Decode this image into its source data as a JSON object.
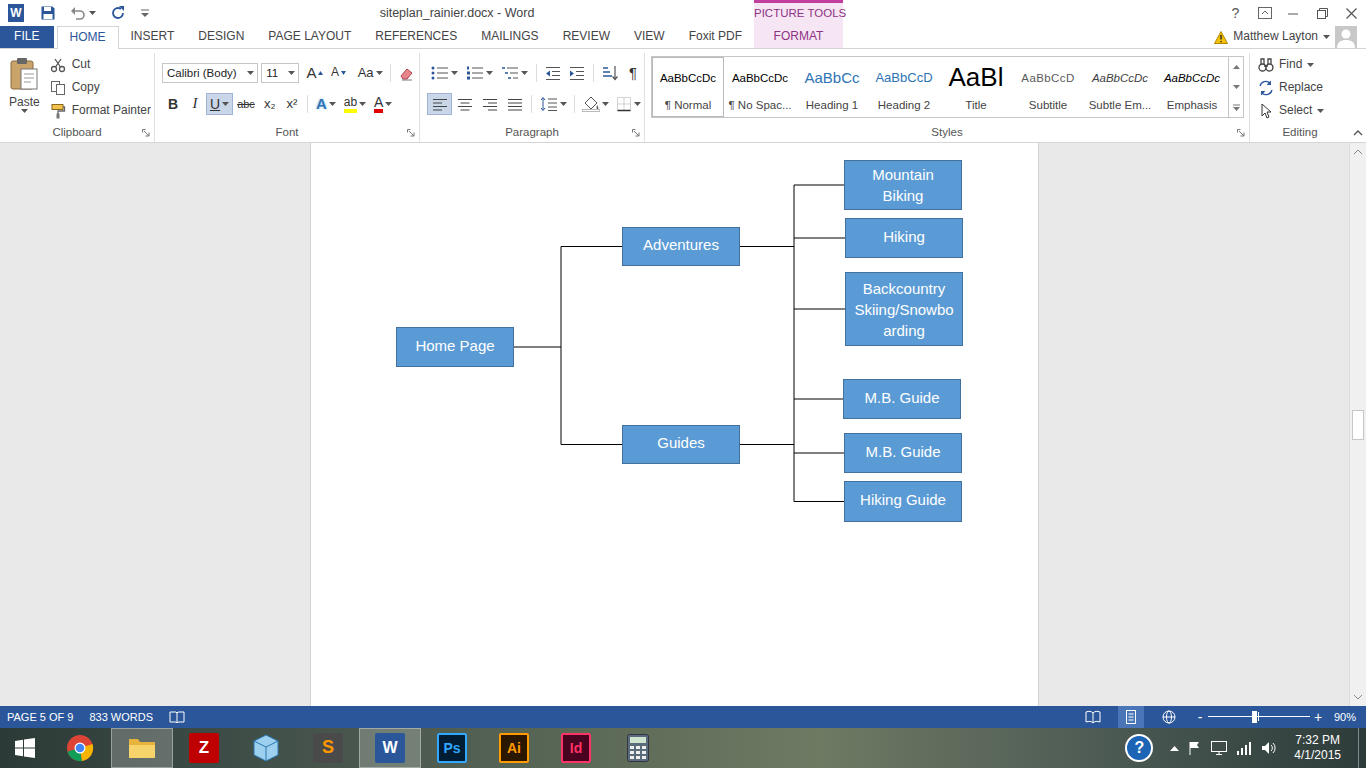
{
  "window": {
    "app_glyph": "W",
    "title": "siteplan_rainier.docx - Word",
    "context_group": "PICTURE TOOLS",
    "help": "?"
  },
  "tabs": [
    {
      "label": "FILE",
      "kind": "file",
      "selected": false
    },
    {
      "label": "HOME",
      "kind": "tab",
      "selected": true
    },
    {
      "label": "INSERT",
      "kind": "tab",
      "selected": false
    },
    {
      "label": "DESIGN",
      "kind": "tab",
      "selected": false
    },
    {
      "label": "PAGE LAYOUT",
      "kind": "tab",
      "selected": false
    },
    {
      "label": "REFERENCES",
      "kind": "tab",
      "selected": false
    },
    {
      "label": "MAILINGS",
      "kind": "tab",
      "selected": false
    },
    {
      "label": "REVIEW",
      "kind": "tab",
      "selected": false
    },
    {
      "label": "VIEW",
      "kind": "tab",
      "selected": false
    },
    {
      "label": "Foxit PDF",
      "kind": "tab",
      "selected": false
    },
    {
      "label": "FORMAT",
      "kind": "context",
      "selected": false
    }
  ],
  "account": {
    "user": "Matthew Layton"
  },
  "ribbon": {
    "clipboard": {
      "label": "Clipboard",
      "paste": "Paste",
      "items": [
        "Cut",
        "Copy",
        "Format Painter"
      ]
    },
    "font": {
      "label": "Font",
      "font_name": "Calibri (Body)",
      "font_size": "11",
      "grow": "A",
      "shrink": "A",
      "change_case": "Aa",
      "buttons": [
        {
          "label": "B",
          "kind": "bold",
          "selected": false
        },
        {
          "label": "I",
          "kind": "italic",
          "selected": false
        },
        {
          "label": "U",
          "kind": "underline",
          "selected": true
        },
        {
          "label": "abc",
          "kind": "strike",
          "selected": false
        },
        {
          "label": "x₂",
          "kind": "subscript",
          "selected": false
        },
        {
          "label": "x²",
          "kind": "superscript",
          "selected": false
        },
        {
          "label": "A",
          "kind": "effects",
          "selected": false
        },
        {
          "label": "ab",
          "kind": "highlight",
          "selected": false
        },
        {
          "label": "A",
          "kind": "color",
          "selected": false
        }
      ]
    },
    "paragraph": {
      "label": "Paragraph",
      "show_marks": "¶",
      "align": [
        {
          "kind": "left",
          "selected": true
        },
        {
          "kind": "center",
          "selected": false
        },
        {
          "kind": "right",
          "selected": false
        },
        {
          "kind": "justify",
          "selected": false
        }
      ]
    },
    "styles": {
      "label": "Styles",
      "items": [
        {
          "preview": "AaBbCcDc",
          "label": "¶ Normal",
          "kind": "normal",
          "selected": true
        },
        {
          "preview": "AaBbCcDc",
          "label": "¶ No Spac...",
          "kind": "nospacing",
          "selected": false
        },
        {
          "preview": "AaBbCc",
          "label": "Heading 1",
          "kind": "heading1",
          "selected": false
        },
        {
          "preview": "AaBbCcD",
          "label": "Heading 2",
          "kind": "heading2",
          "selected": false
        },
        {
          "preview": "AaBl",
          "label": "Title",
          "kind": "title",
          "selected": false
        },
        {
          "preview": "AaBbCcD",
          "label": "Subtitle",
          "kind": "subtitle",
          "selected": false
        },
        {
          "preview": "AaBbCcDc",
          "label": "Subtle Em...",
          "kind": "subtle",
          "selected": false
        },
        {
          "preview": "AaBbCcDc",
          "label": "Emphasis",
          "kind": "emphasis",
          "selected": false
        }
      ]
    },
    "editing": {
      "label": "Editing",
      "items": [
        "Find",
        "Replace",
        "Select"
      ]
    }
  },
  "document": {
    "scroll_level": 0.5,
    "diagram": {
      "nodes": [
        {
          "label": "Home Page"
        },
        {
          "label": "Adventures"
        },
        {
          "label": "Guides"
        },
        {
          "label": "Mountain Biking"
        },
        {
          "label": "Hiking"
        },
        {
          "label": "Backcountry Skiing/Snowboarding"
        },
        {
          "label": "M.B. Guide"
        },
        {
          "label": "M.B. Guide"
        },
        {
          "label": "Hiking Guide"
        }
      ],
      "edges": [
        [
          0,
          1
        ],
        [
          0,
          2
        ],
        [
          1,
          3
        ],
        [
          1,
          4
        ],
        [
          1,
          5
        ],
        [
          2,
          6
        ],
        [
          2,
          7
        ],
        [
          2,
          8
        ]
      ]
    }
  },
  "status_bar": {
    "page": "PAGE 5 OF 9",
    "words": "833 WORDS",
    "views": [
      {
        "kind": "read",
        "selected": false
      },
      {
        "kind": "print",
        "selected": true
      },
      {
        "kind": "web",
        "selected": false
      }
    ],
    "zoom_out": "-",
    "zoom_in": "+",
    "zoom": "90%",
    "zoom_level": 0.45
  },
  "taskbar": {
    "apps": [
      {
        "kind": "chrome",
        "active": false
      },
      {
        "kind": "explorer",
        "active": true
      },
      {
        "kind": "filezilla",
        "glyph": "Z",
        "active": false
      },
      {
        "kind": "cube",
        "active": false
      },
      {
        "kind": "sublime",
        "glyph": "S",
        "active": false
      },
      {
        "kind": "word",
        "glyph": "W",
        "active": true
      },
      {
        "kind": "photoshop",
        "glyph": "Ps",
        "active": false
      },
      {
        "kind": "illustrator",
        "glyph": "Ai",
        "active": false
      },
      {
        "kind": "indesign",
        "glyph": "Id",
        "active": false
      },
      {
        "kind": "calculator",
        "active": false
      }
    ],
    "help": "?",
    "clock": {
      "time": "7:32 PM",
      "date": "4/1/2015"
    }
  }
}
